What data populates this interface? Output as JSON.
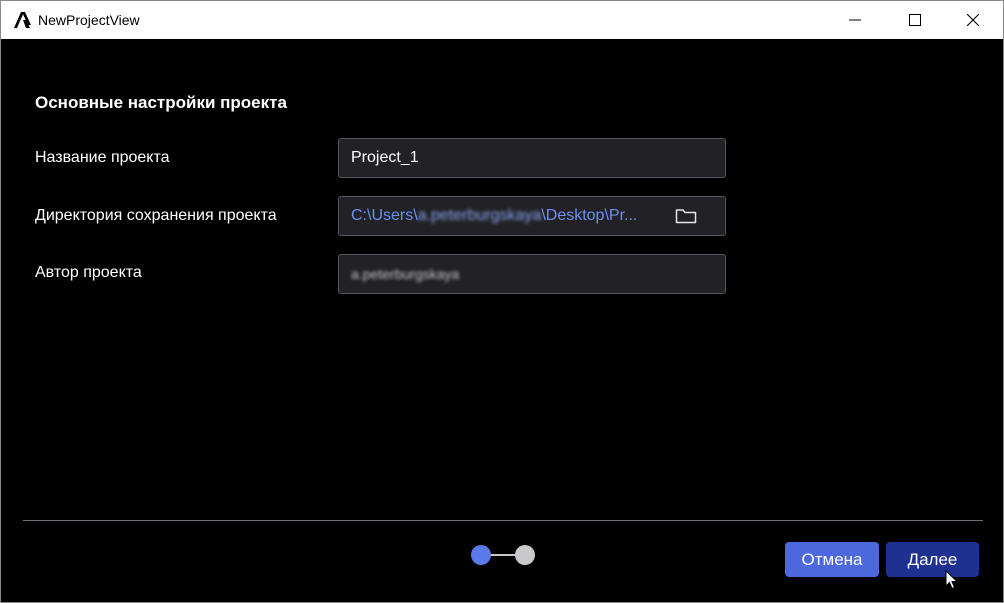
{
  "window": {
    "title": "NewProjectView"
  },
  "form": {
    "section_title": "Основные настройки проекта",
    "name_label": "Название проекта",
    "name_value": "Project_1",
    "dir_label": "Директория сохранения проекта",
    "dir_prefix": "C:\\Users\\",
    "dir_redacted": "a.peterburgskaya",
    "dir_suffix": "\\Desktop\\Pr...",
    "author_label": "Автор проекта",
    "author_value": "a.peterburgskaya"
  },
  "stepper": {
    "current_step": 1,
    "total_steps": 2
  },
  "buttons": {
    "cancel_label": "Отмена",
    "next_label": "Далее"
  },
  "colors": {
    "background": "#000000",
    "field_background": "#222226",
    "path_text": "#6d8ff0",
    "accent": "#4d67dd",
    "primary": "#1f3190"
  },
  "icons": {
    "app": "app-logo-icon",
    "minimize": "minimize-icon",
    "maximize": "maximize-icon",
    "close": "close-icon",
    "folder": "folder-icon"
  }
}
